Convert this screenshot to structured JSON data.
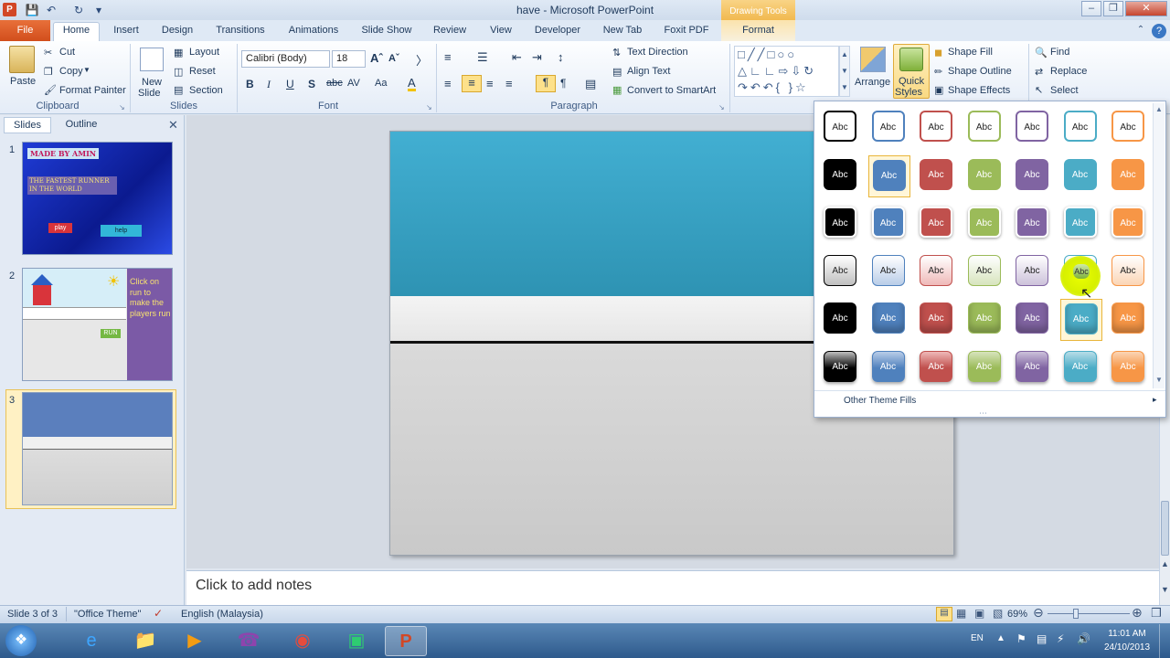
{
  "window": {
    "title": "have  -  Microsoft PowerPoint",
    "contextual_header": "Drawing Tools"
  },
  "tabs": [
    {
      "label": "File"
    },
    {
      "label": "Home"
    },
    {
      "label": "Insert"
    },
    {
      "label": "Design"
    },
    {
      "label": "Transitions"
    },
    {
      "label": "Animations"
    },
    {
      "label": "Slide Show"
    },
    {
      "label": "Review"
    },
    {
      "label": "View"
    },
    {
      "label": "Developer"
    },
    {
      "label": "New Tab"
    },
    {
      "label": "Foxit PDF"
    },
    {
      "label": "Format"
    }
  ],
  "ribbon": {
    "clipboard": {
      "paste": "Paste",
      "cut": "Cut",
      "copy": "Copy",
      "format_painter": "Format Painter",
      "label": "Clipboard"
    },
    "slides": {
      "new_slide_1": "New",
      "new_slide_2": "Slide",
      "layout": "Layout",
      "reset": "Reset",
      "section": "Section",
      "label": "Slides"
    },
    "font": {
      "name": "Calibri (Body)",
      "size": "18",
      "label": "Font"
    },
    "paragraph": {
      "text_direction": "Text Direction",
      "align_text": "Align Text",
      "convert_smartart": "Convert to SmartArt",
      "label": "Paragraph"
    },
    "drawing": {
      "arrange": "Arrange",
      "quick_styles_1": "Quick",
      "quick_styles_2": "Styles",
      "shape_fill": "Shape Fill",
      "shape_outline": "Shape Outline",
      "shape_effects": "Shape Effects"
    },
    "editing": {
      "find": "Find",
      "replace": "Replace",
      "select": "Select"
    }
  },
  "left_pane": {
    "tab_slides": "Slides",
    "tab_outline": "Outline",
    "thumbs": [
      {
        "num": "1",
        "title": "MADE BY AMIN",
        "subtitle": "THE FASTEST RUNNER IN THE WORLD",
        "btn1": "play",
        "btn2": "help"
      },
      {
        "num": "2",
        "side_text": "Click on run to make the players run",
        "btn": "RUN"
      },
      {
        "num": "3"
      }
    ]
  },
  "notes": {
    "placeholder": "Click to add notes"
  },
  "gallery": {
    "swatch_text": "Abc",
    "footer": "Other Theme Fills",
    "colors": [
      "#000000",
      "#4f81bd",
      "#c0504d",
      "#9bbb59",
      "#8064a2",
      "#4bacc6",
      "#f79646"
    ],
    "light_colors": [
      "#bfbfbf",
      "#b9cde8",
      "#efb9b8",
      "#d7e4bd",
      "#ccc1da",
      "#b7dde8",
      "#fbd5b5"
    ]
  },
  "status": {
    "slide": "Slide 3 of 3",
    "theme": "\"Office Theme\"",
    "language": "English (Malaysia)",
    "zoom": "69%"
  },
  "taskbar": {
    "lang": "EN",
    "time": "11:01 AM",
    "date": "24/10/2013"
  }
}
